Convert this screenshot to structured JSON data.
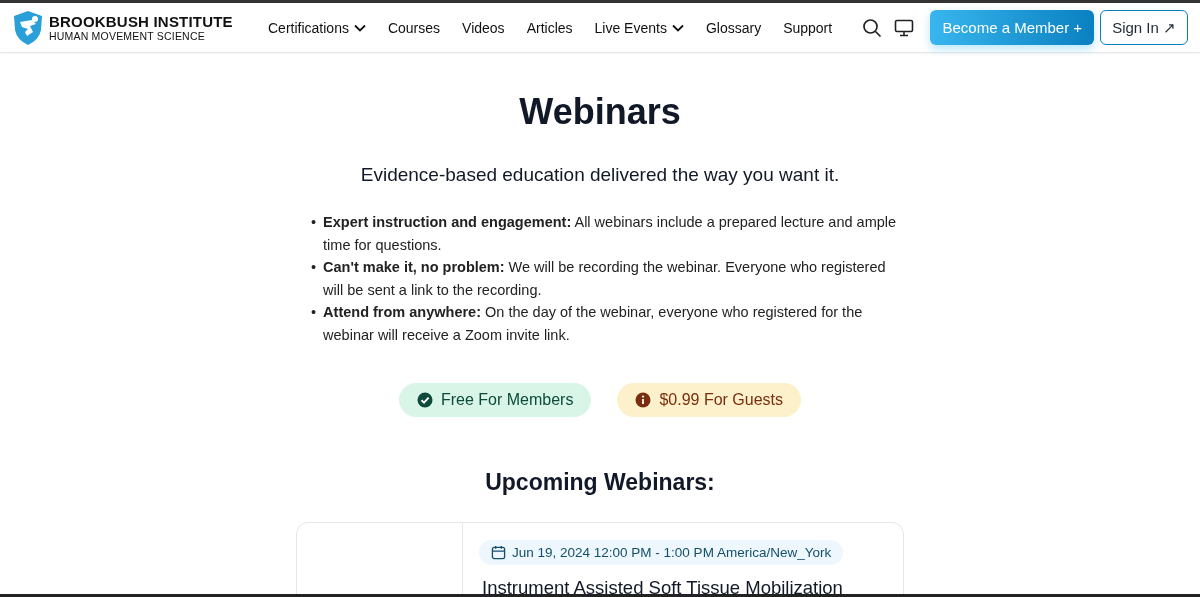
{
  "header": {
    "brand": {
      "name": "BROOKBUSH INSTITUTE",
      "tagline": "HUMAN MOVEMENT SCIENCE"
    },
    "nav": [
      {
        "label": "Certifications",
        "dropdown": true
      },
      {
        "label": "Courses",
        "dropdown": false
      },
      {
        "label": "Videos",
        "dropdown": false
      },
      {
        "label": "Articles",
        "dropdown": false
      },
      {
        "label": "Live Events",
        "dropdown": true
      },
      {
        "label": "Glossary",
        "dropdown": false
      },
      {
        "label": "Support",
        "dropdown": false
      }
    ],
    "member_button": "Become a Member +",
    "sign_in_button": "Sign In ↗"
  },
  "page": {
    "title": "Webinars",
    "subtitle": "Evidence-based education delivered the way you want it.",
    "bullets": [
      {
        "marker": "•",
        "lead": "Expert instruction and engagement:",
        "text": "All webinars include a prepared lecture and ample time for questions."
      },
      {
        "marker": "•",
        "lead": "Can't make it, no problem:",
        "text": "We will be recording the webinar. Everyone who registered will be sent a link to the recording."
      },
      {
        "marker": "•",
        "lead": "Attend from anywhere:",
        "text": "On the day of the webinar, everyone who registered for the webinar will receive a Zoom invite link."
      }
    ],
    "badges": [
      {
        "kind": "success",
        "label": "Free For Members"
      },
      {
        "kind": "info",
        "label": "$0.99 For Guests"
      }
    ],
    "section_title": "Upcoming Webinars:",
    "webinars": [
      {
        "date": "Jun 19, 2024 12:00 PM - 1:00 PM America/New_York",
        "title": "Instrument Assisted Soft Tissue Mobilization"
      }
    ]
  }
}
